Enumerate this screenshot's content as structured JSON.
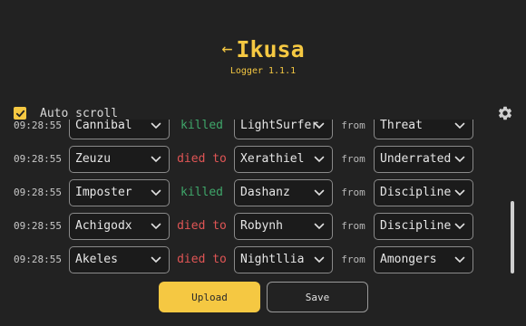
{
  "header": {
    "title": "Ikusa",
    "version": "Logger 1.1.1"
  },
  "toolbar": {
    "auto_scroll_label": "Auto scroll",
    "auto_scroll_checked": true
  },
  "log": {
    "rows": [
      {
        "time": "09:28:55",
        "actor": "Cannibal",
        "action": "killed",
        "target": "LightSurfer",
        "from_label": "from",
        "source": "Threat"
      },
      {
        "time": "09:28:55",
        "actor": "Zeuzu",
        "action": "died to",
        "target": "Xerathiel",
        "from_label": "from",
        "source": "Underrated"
      },
      {
        "time": "09:28:55",
        "actor": "Imposter",
        "action": "killed",
        "target": "Dashanz",
        "from_label": "from",
        "source": "Discipline"
      },
      {
        "time": "09:28:55",
        "actor": "Achigodx",
        "action": "died to",
        "target": "Robynh",
        "from_label": "from",
        "source": "Discipline"
      },
      {
        "time": "09:28:55",
        "actor": "Akeles",
        "action": "died to",
        "target": "Nightllia",
        "from_label": "from",
        "source": "Amongers"
      }
    ]
  },
  "footer": {
    "upload_label": "Upload",
    "save_label": "Save"
  },
  "colors": {
    "accent": "#f5c842",
    "died": "#e05555",
    "killed": "#3fa66a"
  }
}
